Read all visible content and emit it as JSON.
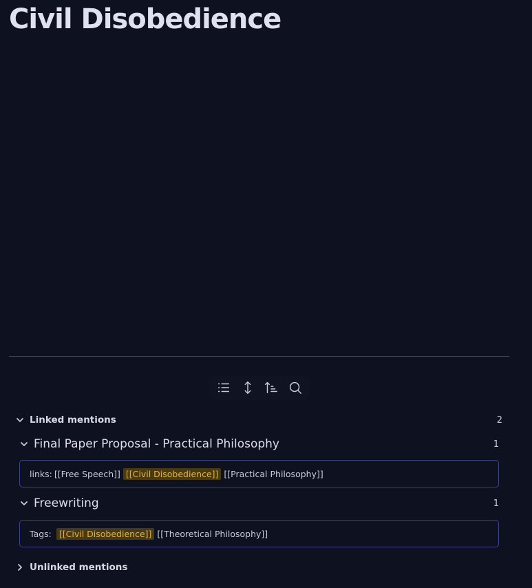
{
  "note": {
    "title": "Civil Disobedience"
  },
  "toolbar": {
    "icons": [
      "list-icon",
      "expand-vertical-icon",
      "sort-icon",
      "search-icon"
    ]
  },
  "linked_mentions": {
    "label": "Linked mentions",
    "count": "2",
    "files": [
      {
        "title": "Final Paper Proposal - Practical Philosophy",
        "count": "1",
        "prefix": "links:",
        "before": "[[Free Speech]]",
        "match": "[[Civil Disobedience]]",
        "after": "[[Practical Philosophy]]"
      },
      {
        "title": "Freewriting",
        "count": "1",
        "prefix": "Tags:",
        "before": "",
        "match": "[[Civil Disobedience]]",
        "after": "[[Theoretical Philosophy]]"
      }
    ]
  },
  "unlinked_mentions": {
    "label": "Unlinked mentions"
  },
  "colors": {
    "background": "#0e1120",
    "divider": "#3e4590",
    "highlight_bg": "#4a3a12",
    "highlight_text": "#e3b23c"
  }
}
